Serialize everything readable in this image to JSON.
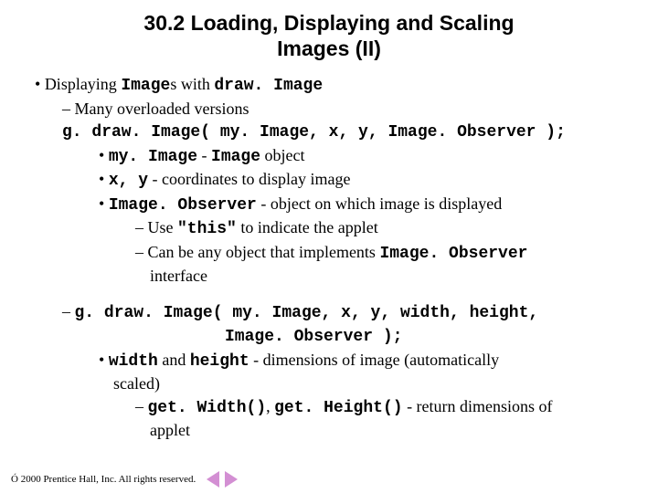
{
  "title_l1": "30.2  Loading, Displaying and Scaling",
  "title_l2": "Images (II)",
  "b1_pre": "Displaying ",
  "b1_code1": "Image",
  "b1_mid": "s with ",
  "b1_code2": "draw. Image",
  "b2_1": "Many overloaded versions",
  "sig1": "g. draw. Image( my. Image, x, y, Image. Observer );",
  "b3_1_code": "my. Image",
  "b3_1_sep": " - ",
  "b3_1_code2": "Image",
  "b3_1_txt": " object",
  "b3_2_code": "x, y",
  "b3_2_txt": " - coordinates to display image",
  "b3_3_code": "Image. Observer",
  "b3_3_txt": " - object on which image is displayed",
  "b4_1_pre": "Use ",
  "b4_1_code": "\"this\"",
  "b4_1_post": " to indicate the applet",
  "b4_2_pre": "Can be any object that implements ",
  "b4_2_code": "Image. Observer",
  "b4_2_post": "interface",
  "sig2a": "g. draw. Image( my. Image, x, y, width, height,",
  "sig2b": "Image. Observer );",
  "b3_4_code": "width",
  "b3_4_and": " and ",
  "b3_4_code2": "height",
  "b3_4_txt": " - dimensions of image (automatically",
  "b3_4_txt2": "scaled)",
  "b4_3_code": "get. Width()",
  "b4_3_sep": ", ",
  "b4_3_code2": "get. Height()",
  "b4_3_txt": " - return dimensions of",
  "b4_3_txt2": "applet",
  "footer": "Ó 2000 Prentice Hall, Inc.  All rights reserved."
}
